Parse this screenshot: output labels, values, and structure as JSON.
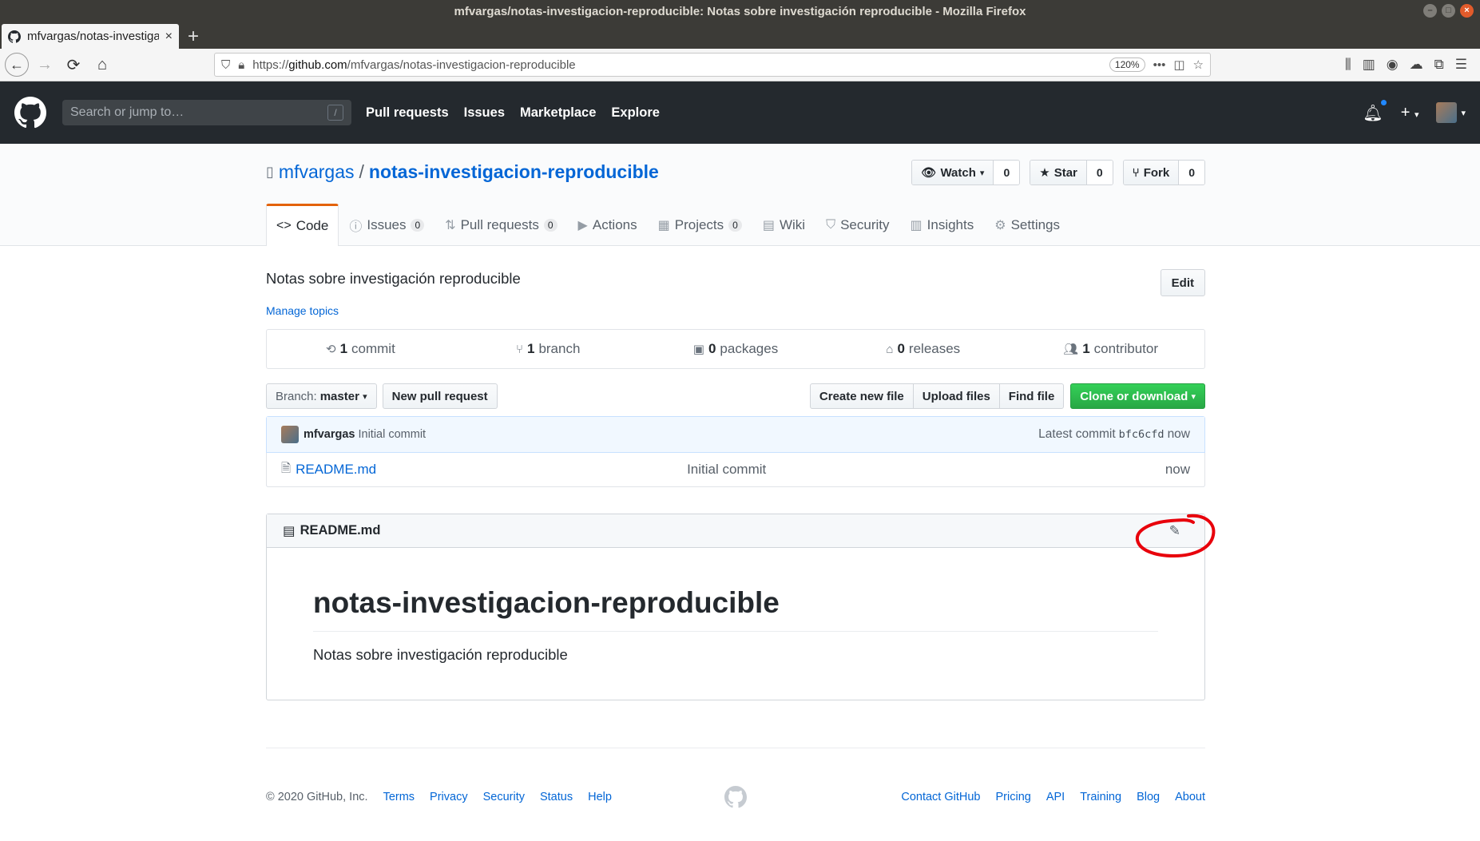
{
  "window": {
    "title": "mfvargas/notas-investigacion-reproducible: Notas sobre investigación reproducible - Mozilla Firefox"
  },
  "browser": {
    "tab_title": "mfvargas/notas-investigacion-reproducible",
    "url_prefix": "https://",
    "url_domain": "github.com",
    "url_path": "/mfvargas/notas-investigacion-reproducible",
    "zoom": "120%"
  },
  "gh": {
    "search_placeholder": "Search or jump to…",
    "search_key": "/",
    "nav": [
      "Pull requests",
      "Issues",
      "Marketplace",
      "Explore"
    ],
    "notification_color": "#2188ff"
  },
  "repo": {
    "owner": "mfvargas",
    "separator": "/",
    "name": "notas-investigacion-reproducible",
    "watch_label": "Watch",
    "watch_count": "0",
    "star_label": "Star",
    "star_count": "0",
    "fork_label": "Fork",
    "fork_count": "0",
    "tabs": [
      {
        "label": "Code"
      },
      {
        "label": "Issues",
        "count": "0"
      },
      {
        "label": "Pull requests",
        "count": "0"
      },
      {
        "label": "Actions"
      },
      {
        "label": "Projects",
        "count": "0"
      },
      {
        "label": "Wiki"
      },
      {
        "label": "Security"
      },
      {
        "label": "Insights"
      },
      {
        "label": "Settings"
      }
    ],
    "accent_color": "#e36209"
  },
  "main": {
    "description": "Notas sobre investigación reproducible",
    "edit_label": "Edit",
    "manage_topics": "Manage topics",
    "summary": [
      {
        "num": "1",
        "label": "commit"
      },
      {
        "num": "1",
        "label": "branch"
      },
      {
        "num": "0",
        "label": "packages"
      },
      {
        "num": "0",
        "label": "releases"
      },
      {
        "num": "1",
        "label": "contributor"
      }
    ],
    "branch_prefix": "Branch:",
    "branch_name": "master",
    "new_pull_request": "New pull request",
    "create_new_file": "Create new file",
    "upload_files": "Upload files",
    "find_file": "Find file",
    "clone_or_download": "Clone or download",
    "primary_color": "#28a745"
  },
  "commit": {
    "author": "mfvargas",
    "message": "Initial commit",
    "latest_label": "Latest commit",
    "sha": "bfc6cfd",
    "age": "now"
  },
  "files": [
    {
      "name": "README.md",
      "commit": "Initial commit",
      "age": "now"
    }
  ],
  "readme": {
    "filename": "README.md",
    "heading": "notas-investigacion-reproducible",
    "paragraph": "Notas sobre investigación reproducible",
    "annotation_color": "#e8000b"
  },
  "footer": {
    "copyright": "© 2020 GitHub, Inc.",
    "left_links": [
      "Terms",
      "Privacy",
      "Security",
      "Status",
      "Help"
    ],
    "right_links": [
      "Contact GitHub",
      "Pricing",
      "API",
      "Training",
      "Blog",
      "About"
    ]
  }
}
